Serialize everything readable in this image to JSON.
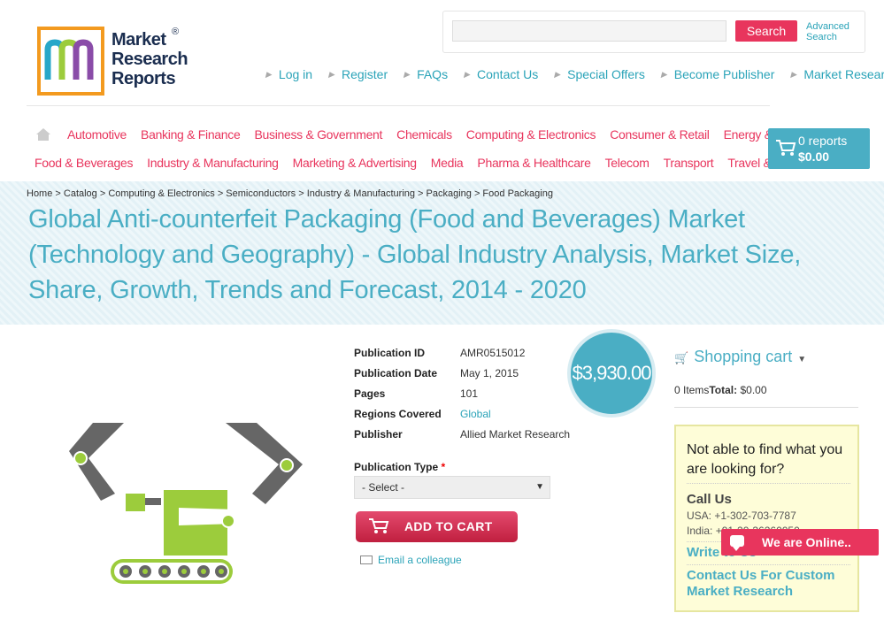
{
  "header": {
    "logo_line1": "Market",
    "logo_line2": "Research",
    "logo_line3": "Reports",
    "logo_reg": "®",
    "search_button": "Search",
    "advanced_line1": "Advanced",
    "advanced_line2": "Search",
    "top_links": [
      "Log in",
      "Register",
      "FAQs",
      "Contact Us",
      "Special Offers",
      "Become Publisher",
      "Market Research Blog"
    ]
  },
  "categories": {
    "row1": [
      "Automotive",
      "Banking & Finance",
      "Business & Government",
      "Chemicals",
      "Computing & Electronics",
      "Consumer & Retail",
      "Energy & Utilities"
    ],
    "row2": [
      "Food & Beverages",
      "Industry & Manufacturing",
      "Marketing & Advertising",
      "Media",
      "Pharma & Healthcare",
      "Telecom",
      "Transport",
      "Travel & Leisure"
    ]
  },
  "cart": {
    "reports": "0 reports",
    "total": "$0.00"
  },
  "breadcrumb": "Home > Catalog > Computing & Electronics > Semiconductors > Industry & Manufacturing > Packaging > Food Packaging",
  "title": "Global Anti-counterfeit Packaging (Food and Beverages) Market (Technology and Geography) - Global Industry Analysis, Market Size, Share, Growth, Trends and Forecast, 2014 - 2020",
  "product": {
    "fields": [
      {
        "key": "Publication ID",
        "value": "AMR0515012"
      },
      {
        "key": "Publication Date",
        "value": "May 1, 2015"
      },
      {
        "key": "Pages",
        "value": "101"
      },
      {
        "key": "Regions Covered",
        "value": "Global"
      },
      {
        "key": "Publisher",
        "value": "Allied Market Research"
      }
    ],
    "price": "$3,930.00",
    "publication_type_label": "Publication Type",
    "required_mark": "*",
    "select_value": "- Select -",
    "add_to_cart": "ADD TO CART",
    "email_colleague": "Email a colleague"
  },
  "sidebar": {
    "shopping_cart": "Shopping cart",
    "items_text": "0 Items",
    "total_label": "Total:",
    "total_value": "$0.00",
    "help_question": "Not able to find what you are looking for?",
    "call_us": "Call Us",
    "usa_phone": "USA: +1-302-703-7787",
    "india_phone": "India: +91-20-36260050",
    "write_to_us": "Write to Us",
    "custom_research": "Contact Us For Custom Market Research"
  },
  "chat": {
    "label": "We are Online.."
  },
  "colors": {
    "accent": "#4aaec4",
    "brand_pink": "#e8355d",
    "logo_orange": "#f39a1f",
    "product_green": "#9ccc3c"
  },
  "icons": [
    "home-icon",
    "cart-icon",
    "arrow-icon",
    "caret-down-icon",
    "envelope-icon",
    "chat-bubble-icon"
  ]
}
